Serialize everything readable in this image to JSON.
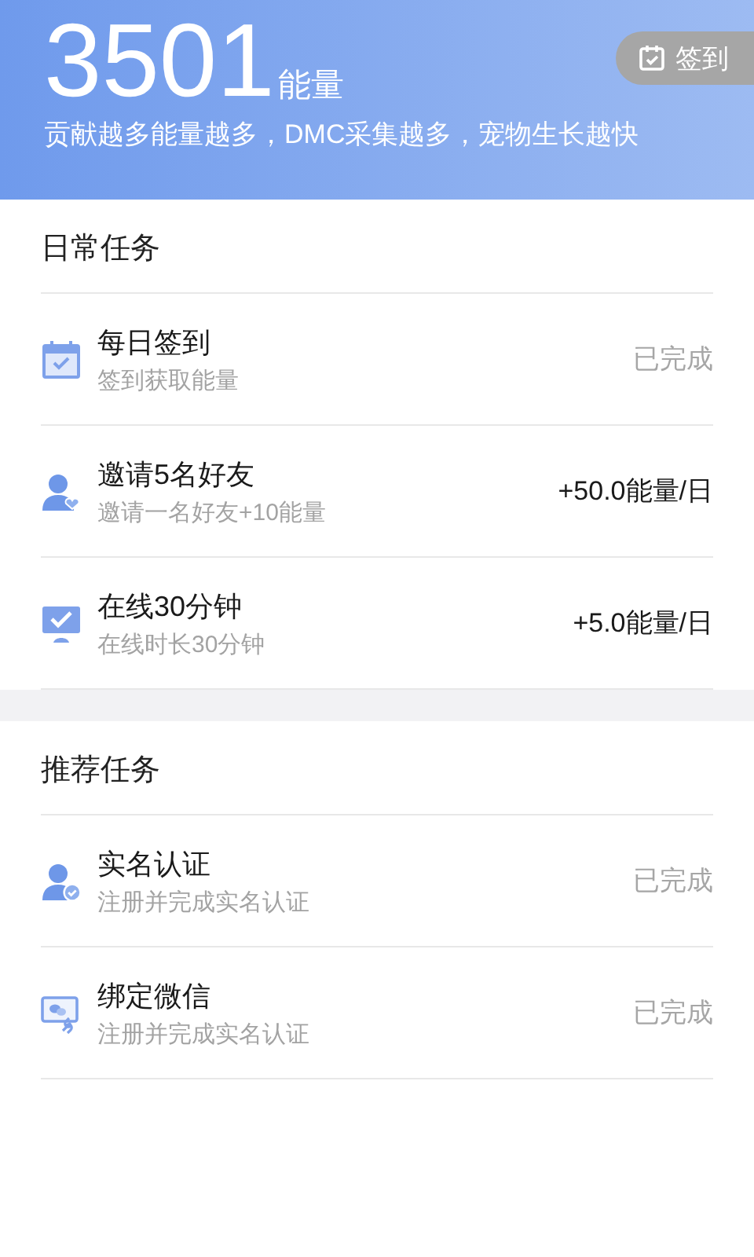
{
  "header": {
    "energy": "3501",
    "unit": "能量",
    "subtitle": "贡献越多能量越多，DMC采集越多，宠物生长越快",
    "checkin_button": "签到"
  },
  "sections": [
    {
      "title": "日常任务",
      "tasks": [
        {
          "kind": "calendar",
          "title": "每日签到",
          "subtitle": "签到获取能量",
          "status": "已完成",
          "completed": true
        },
        {
          "kind": "invite",
          "title": "邀请5名好友",
          "subtitle": "邀请一名好友+10能量",
          "status": "+50.0能量/日",
          "completed": false
        },
        {
          "kind": "online",
          "title": "在线30分钟",
          "subtitle": "在线时长30分钟",
          "status": "+5.0能量/日",
          "completed": false
        }
      ]
    },
    {
      "title": "推荐任务",
      "tasks": [
        {
          "kind": "verify",
          "title": "实名认证",
          "subtitle": "注册并完成实名认证",
          "status": "已完成",
          "completed": true
        },
        {
          "kind": "wechat",
          "title": "绑定微信",
          "subtitle": "注册并完成实名认证",
          "status": "已完成",
          "completed": true
        }
      ]
    }
  ]
}
